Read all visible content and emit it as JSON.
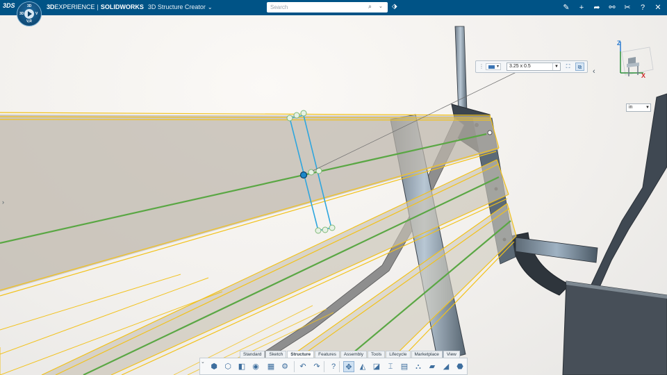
{
  "header": {
    "brand_prefix": "3D",
    "brand_experience": "EXPERIENCE",
    "brand_separator": "|",
    "brand_solidworks": "SOLIDWORKS",
    "app_name": "3D Structure Creator",
    "app_chevron": "⌄",
    "ds_logo": "3DS",
    "compass_labels": {
      "top": "3D",
      "left": "3D",
      "right": "V",
      "bottom": "V,R"
    },
    "search_placeholder": "Search",
    "colors": {
      "bar": "#005386"
    }
  },
  "header_actions": [
    {
      "name": "share-icon",
      "glyph": "✎"
    },
    {
      "name": "add-icon",
      "glyph": "+"
    },
    {
      "name": "forward-icon",
      "glyph": "➦"
    },
    {
      "name": "network-icon",
      "glyph": "⚯"
    },
    {
      "name": "tools-icon",
      "glyph": "✂"
    },
    {
      "name": "help-icon",
      "glyph": "?"
    },
    {
      "name": "collapse-icon",
      "glyph": "✕"
    }
  ],
  "property_bar": {
    "profile_value": "3.25 x 0.5",
    "dropdown_arrow": "▼"
  },
  "units": {
    "value": "in",
    "arrow": "▼"
  },
  "triad_labels": {
    "z": "Z",
    "x": "X"
  },
  "tabs": [
    {
      "label": "Standard",
      "active": false
    },
    {
      "label": "Sketch",
      "active": false
    },
    {
      "label": "Structure",
      "active": true
    },
    {
      "label": "Features",
      "active": false
    },
    {
      "label": "Assembly",
      "active": false
    },
    {
      "label": "Tools",
      "active": false
    },
    {
      "label": "Lifecycle",
      "active": false
    },
    {
      "label": "Marketplace",
      "active": false
    },
    {
      "label": "View",
      "active": false
    }
  ],
  "toolbar": [
    {
      "name": "structure-member-icon",
      "glyph": "⬢"
    },
    {
      "name": "trim-extend-icon",
      "glyph": "⬡"
    },
    {
      "name": "gusset-icon",
      "glyph": "◧"
    },
    {
      "name": "end-cap-icon",
      "glyph": "◉"
    },
    {
      "name": "cut-list-icon",
      "glyph": "▦"
    },
    {
      "name": "settings-icon",
      "glyph": "⚙"
    },
    {
      "name": "undo-icon",
      "glyph": "↶"
    },
    {
      "name": "redo-icon",
      "glyph": "↷"
    },
    {
      "name": "help-icon",
      "glyph": "?"
    },
    {
      "name": "select-icon",
      "glyph": "✥"
    },
    {
      "name": "box-view-icon",
      "glyph": "◭"
    },
    {
      "name": "section-icon",
      "glyph": "◪"
    },
    {
      "name": "beam-icon",
      "glyph": "⌶"
    },
    {
      "name": "table-icon",
      "glyph": "▤"
    },
    {
      "name": "weld-icon",
      "glyph": "⛬"
    },
    {
      "name": "plate-icon",
      "glyph": "▰"
    },
    {
      "name": "wedge-icon",
      "glyph": "◢"
    },
    {
      "name": "shell-icon",
      "glyph": "⬣"
    },
    {
      "name": "part-icon",
      "glyph": "◨"
    }
  ]
}
